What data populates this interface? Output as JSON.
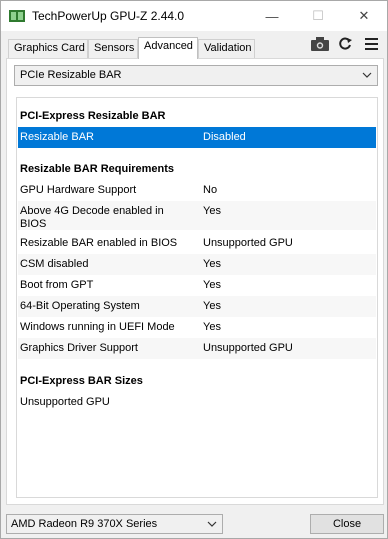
{
  "window": {
    "title": "TechPowerUp GPU-Z 2.44.0",
    "minimize_glyph": "—",
    "maximize_glyph": "☐",
    "close_glyph": "✕"
  },
  "tabs": [
    {
      "label": "Graphics Card",
      "active": false
    },
    {
      "label": "Sensors",
      "active": false
    },
    {
      "label": "Advanced",
      "active": true
    },
    {
      "label": "Validation",
      "active": false
    }
  ],
  "toolbar_icons": [
    "camera-icon",
    "refresh-icon",
    "hamburger-menu-icon"
  ],
  "section_dropdown": {
    "value": "PCIe Resizable BAR"
  },
  "sections": {
    "bar_header": "PCI-Express Resizable BAR",
    "bar_row": {
      "label": "Resizable BAR",
      "value": "Disabled"
    },
    "req_header": "Resizable BAR Requirements",
    "requirements": [
      {
        "label": "GPU Hardware Support",
        "value": "No"
      },
      {
        "label": "Above 4G Decode enabled in BIOS",
        "value": "Yes"
      },
      {
        "label": "Resizable BAR enabled in BIOS",
        "value": "Unsupported GPU"
      },
      {
        "label": "CSM disabled",
        "value": "Yes"
      },
      {
        "label": "Boot from GPT",
        "value": "Yes"
      },
      {
        "label": "64-Bit Operating System",
        "value": "Yes"
      },
      {
        "label": "Windows running in UEFI Mode",
        "value": "Yes"
      },
      {
        "label": "Graphics Driver Support",
        "value": "Unsupported GPU"
      }
    ],
    "sizes_header": "PCI-Express BAR Sizes",
    "sizes_value": "Unsupported GPU"
  },
  "footer": {
    "gpu_select": "AMD Radeon R9 370X Series",
    "close_label": "Close"
  },
  "colors": {
    "selection": "#0078d7",
    "window_bg": "#f0f0f0"
  }
}
